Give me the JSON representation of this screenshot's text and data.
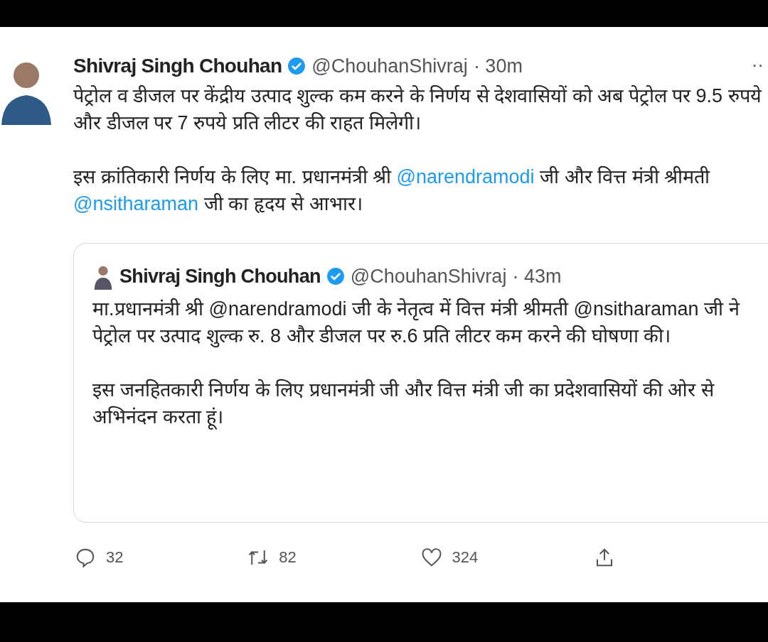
{
  "tweet": {
    "author": "Shivraj Singh Chouhan",
    "verified": true,
    "handle": "@ChouhanShivraj",
    "time": "· 30m",
    "more": "··",
    "paragraphs": [
      [
        {
          "text": "पेट्रोल व डीजल पर केंद्रीय उत्पाद शुल्क कम करने के निर्णय से देशवासियों को अब पेट्रोल पर 9.5 रुपये और डीजल पर 7 रुपये प्रति लीटर की राहत मिलेगी।",
          "kind": "plain"
        }
      ],
      [
        {
          "text": "इस क्रांतिकारी निर्णय के लिए मा. प्रधानमंत्री श्री ",
          "kind": "plain"
        },
        {
          "text": "@narendramodi",
          "kind": "mention"
        },
        {
          "text": " जी और वित्त मंत्री श्रीमती ",
          "kind": "plain"
        },
        {
          "text": "@nsitharaman",
          "kind": "mention"
        },
        {
          "text": " जी का हृदय से आभार।",
          "kind": "plain"
        }
      ]
    ],
    "quoted": {
      "author": "Shivraj Singh Chouhan",
      "verified": true,
      "handle": "@ChouhanShivraj",
      "time": "· 43m",
      "paragraphs": [
        "मा.प्रधानमंत्री श्री @narendramodi जी के नेतृत्व में वित्त मंत्री श्रीमती @nsitharaman जी ने पेट्रोल पर उत्पाद शुल्क रु. 8 और डीजल पर रु.6 प्रति लीटर कम करने की घोषणा की।",
        "इस जनहितकारी निर्णय के लिए प्रधानमंत्री जी और वित्त मंत्री जी का प्रदेशवासियों की ओर से अभिनंदन करता हूं।"
      ]
    },
    "actions": [
      {
        "kind": "reply",
        "count": "32"
      },
      {
        "kind": "retweet",
        "count": "82"
      },
      {
        "kind": "like",
        "count": "324"
      },
      {
        "kind": "share"
      }
    ]
  }
}
